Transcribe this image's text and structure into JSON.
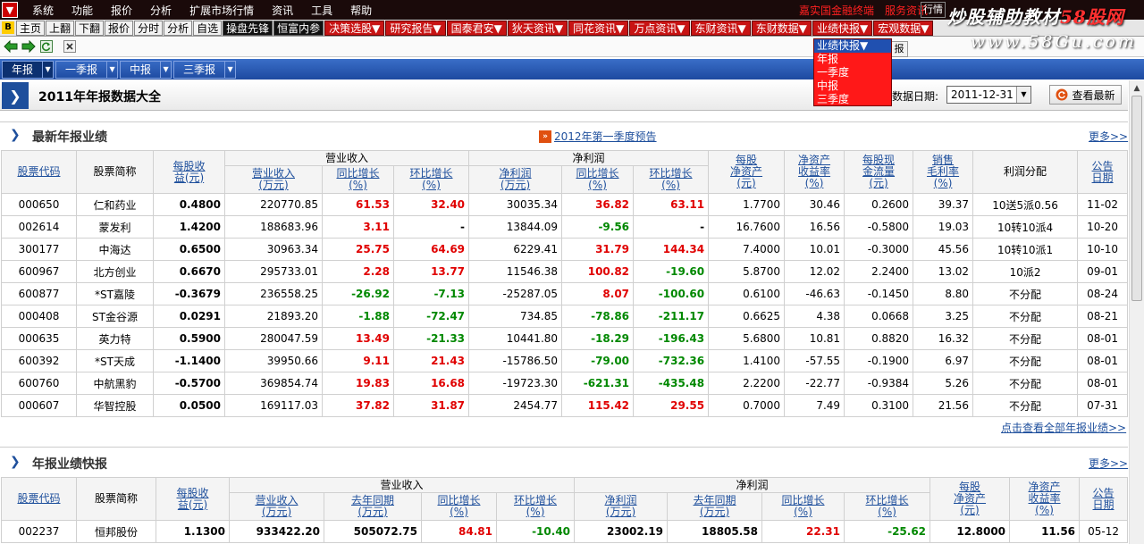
{
  "menubar": {
    "items": [
      "系统",
      "功能",
      "报价",
      "分析",
      "扩展市场行情",
      "资讯",
      "工具",
      "帮助"
    ],
    "alert1": "嘉实国金融终端",
    "alert2": "服务资讯",
    "right_tab": "行情"
  },
  "toolbar": {
    "items": [
      "主页",
      "上翻",
      "下翻",
      "报价",
      "分时",
      "分析",
      "自选",
      "操盘先锋",
      "恒富内参"
    ],
    "red_items": [
      "决策选股▼",
      "研究报告▼",
      "国泰君安▼",
      "狄天资讯▼",
      "同花资讯▼",
      "万点资讯▼",
      "东财资讯▼",
      "东财数据▼",
      "业绩快报▼",
      "宏观数据▼"
    ]
  },
  "watermark": {
    "line1a": "炒股辅助教材",
    "line1b": "58股网",
    "line2": "www.58Gu.com"
  },
  "dropdown": {
    "header": "业绩快报▼",
    "items": [
      "年报",
      "一季度",
      "中报",
      "三季度"
    ],
    "tip": "报"
  },
  "tabs": [
    {
      "label": "年报",
      "active": true
    },
    {
      "label": "一季报",
      "active": false
    },
    {
      "label": "中报",
      "active": false
    },
    {
      "label": "三季报",
      "active": false
    }
  ],
  "page": {
    "title": "2011年年报数据大全",
    "date_label": "数据日期:",
    "date_value": "2011-12-31",
    "refresh_label": "查看最新"
  },
  "section1": {
    "title": "最新年报业绩",
    "promo": "2012年第一季度预告",
    "more": "更多>>",
    "footer_link": "点击查看全部年报业绩>>",
    "group_headers": {
      "revenue": "营业收入",
      "profit": "净利润"
    },
    "headers": {
      "code": "股票代码",
      "name": "股票简称",
      "eps": [
        "每股收",
        "益(元)"
      ],
      "rev": [
        "营业收入",
        "(万元)"
      ],
      "rev_yoy": [
        "同比增长",
        "(%)"
      ],
      "rev_qoq": [
        "环比增长",
        "(%)"
      ],
      "np": [
        "净利润",
        "(万元)"
      ],
      "np_yoy": [
        "同比增长",
        "(%)"
      ],
      "np_qoq": [
        "环比增长",
        "(%)"
      ],
      "bvps": [
        "每股",
        "净资产",
        "(元)"
      ],
      "roe": [
        "净资产",
        "收益率",
        "(%)"
      ],
      "cfps": [
        "每股现",
        "金流量",
        "(元)"
      ],
      "gm": [
        "销售",
        "毛利率",
        "(%)"
      ],
      "div": "利润分配",
      "date": [
        "公告",
        "日期"
      ]
    },
    "rows": [
      {
        "code": "000650",
        "name": "仁和药业",
        "eps": "0.4800",
        "rev": "220770.85",
        "rev_yoy": "61.53",
        "rev_qoq": "32.40",
        "np": "30035.34",
        "np_yoy": "36.82",
        "np_qoq": "63.11",
        "bvps": "1.7700",
        "roe": "30.46",
        "cfps": "0.2600",
        "gm": "39.37",
        "div": "10送5派0.56",
        "date": "11-02"
      },
      {
        "code": "002614",
        "name": "蒙发利",
        "eps": "1.4200",
        "rev": "188683.96",
        "rev_yoy": "3.11",
        "rev_qoq": "-",
        "np": "13844.09",
        "np_yoy": "-9.56",
        "np_qoq": "-",
        "bvps": "16.7600",
        "roe": "16.56",
        "cfps": "-0.5800",
        "gm": "19.03",
        "div": "10转10派4",
        "date": "10-20"
      },
      {
        "code": "300177",
        "name": "中海达",
        "eps": "0.6500",
        "rev": "30963.34",
        "rev_yoy": "25.75",
        "rev_qoq": "64.69",
        "np": "6229.41",
        "np_yoy": "31.79",
        "np_qoq": "144.34",
        "bvps": "7.4000",
        "roe": "10.01",
        "cfps": "-0.3000",
        "gm": "45.56",
        "div": "10转10派1",
        "date": "10-10"
      },
      {
        "code": "600967",
        "name": "北方创业",
        "eps": "0.6670",
        "rev": "295733.01",
        "rev_yoy": "2.28",
        "rev_qoq": "13.77",
        "np": "11546.38",
        "np_yoy": "100.82",
        "np_qoq": "-19.60",
        "bvps": "5.8700",
        "roe": "12.02",
        "cfps": "2.2400",
        "gm": "13.02",
        "div": "10派2",
        "date": "09-01"
      },
      {
        "code": "600877",
        "name": "*ST嘉陵",
        "eps": "-0.3679",
        "rev": "236558.25",
        "rev_yoy": "-26.92",
        "rev_qoq": "-7.13",
        "np": "-25287.05",
        "np_yoy": "8.07",
        "np_qoq": "-100.60",
        "bvps": "0.6100",
        "roe": "-46.63",
        "cfps": "-0.1450",
        "gm": "8.80",
        "div": "不分配",
        "date": "08-24"
      },
      {
        "code": "000408",
        "name": "ST金谷源",
        "eps": "0.0291",
        "rev": "21893.20",
        "rev_yoy": "-1.88",
        "rev_qoq": "-72.47",
        "np": "734.85",
        "np_yoy": "-78.86",
        "np_qoq": "-211.17",
        "bvps": "0.6625",
        "roe": "4.38",
        "cfps": "0.0668",
        "gm": "3.25",
        "div": "不分配",
        "date": "08-21"
      },
      {
        "code": "000635",
        "name": "英力特",
        "eps": "0.5900",
        "rev": "280047.59",
        "rev_yoy": "13.49",
        "rev_qoq": "-21.33",
        "np": "10441.80",
        "np_yoy": "-18.29",
        "np_qoq": "-196.43",
        "bvps": "5.6800",
        "roe": "10.81",
        "cfps": "0.8820",
        "gm": "16.32",
        "div": "不分配",
        "date": "08-01"
      },
      {
        "code": "600392",
        "name": "*ST天成",
        "eps": "-1.1400",
        "rev": "39950.66",
        "rev_yoy": "9.11",
        "rev_qoq": "21.43",
        "np": "-15786.50",
        "np_yoy": "-79.00",
        "np_qoq": "-732.36",
        "bvps": "1.4100",
        "roe": "-57.55",
        "cfps": "-0.1900",
        "gm": "6.97",
        "div": "不分配",
        "date": "08-01"
      },
      {
        "code": "600760",
        "name": "中航黑豹",
        "eps": "-0.5700",
        "rev": "369854.74",
        "rev_yoy": "19.83",
        "rev_qoq": "16.68",
        "np": "-19723.30",
        "np_yoy": "-621.31",
        "np_qoq": "-435.48",
        "bvps": "2.2200",
        "roe": "-22.77",
        "cfps": "-0.9384",
        "gm": "5.26",
        "div": "不分配",
        "date": "08-01"
      },
      {
        "code": "000607",
        "name": "华智控股",
        "eps": "0.0500",
        "rev": "169117.03",
        "rev_yoy": "37.82",
        "rev_qoq": "31.87",
        "np": "2454.77",
        "np_yoy": "115.42",
        "np_qoq": "29.55",
        "bvps": "0.7000",
        "roe": "7.49",
        "cfps": "0.3100",
        "gm": "21.56",
        "div": "不分配",
        "date": "07-31"
      }
    ]
  },
  "section2": {
    "title": "年报业绩快报",
    "more": "更多>>",
    "group_headers": {
      "revenue": "营业收入",
      "profit": "净利润"
    },
    "headers": {
      "code": "股票代码",
      "name": "股票简称",
      "eps": [
        "每股收",
        "益(元)"
      ],
      "rev": [
        "营业收入",
        "(万元)"
      ],
      "rev_prev": [
        "去年同期",
        "(万元)"
      ],
      "rev_yoy": [
        "同比增长",
        "(%)"
      ],
      "rev_qoq": [
        "环比增长",
        "(%)"
      ],
      "np": [
        "净利润",
        "(万元)"
      ],
      "np_prev": [
        "去年同期",
        "(万元)"
      ],
      "np_yoy": [
        "同比增长",
        "(%)"
      ],
      "np_qoq": [
        "环比增长",
        "(%)"
      ],
      "bvps": [
        "每股",
        "净资产",
        "(元)"
      ],
      "roe": [
        "净资产",
        "收益率",
        "(%)"
      ],
      "date": [
        "公告",
        "日期"
      ]
    },
    "rows": [
      {
        "code": "002237",
        "name": "恒邦股份",
        "eps": "1.1300",
        "rev": "933422.20",
        "rev_prev": "505072.75",
        "rev_yoy": "84.81",
        "rev_qoq": "-10.40",
        "np": "23002.19",
        "np_prev": "18805.58",
        "np_yoy": "22.31",
        "np_qoq": "-25.62",
        "bvps": "12.8000",
        "roe": "11.56",
        "date": "05-12"
      }
    ]
  }
}
